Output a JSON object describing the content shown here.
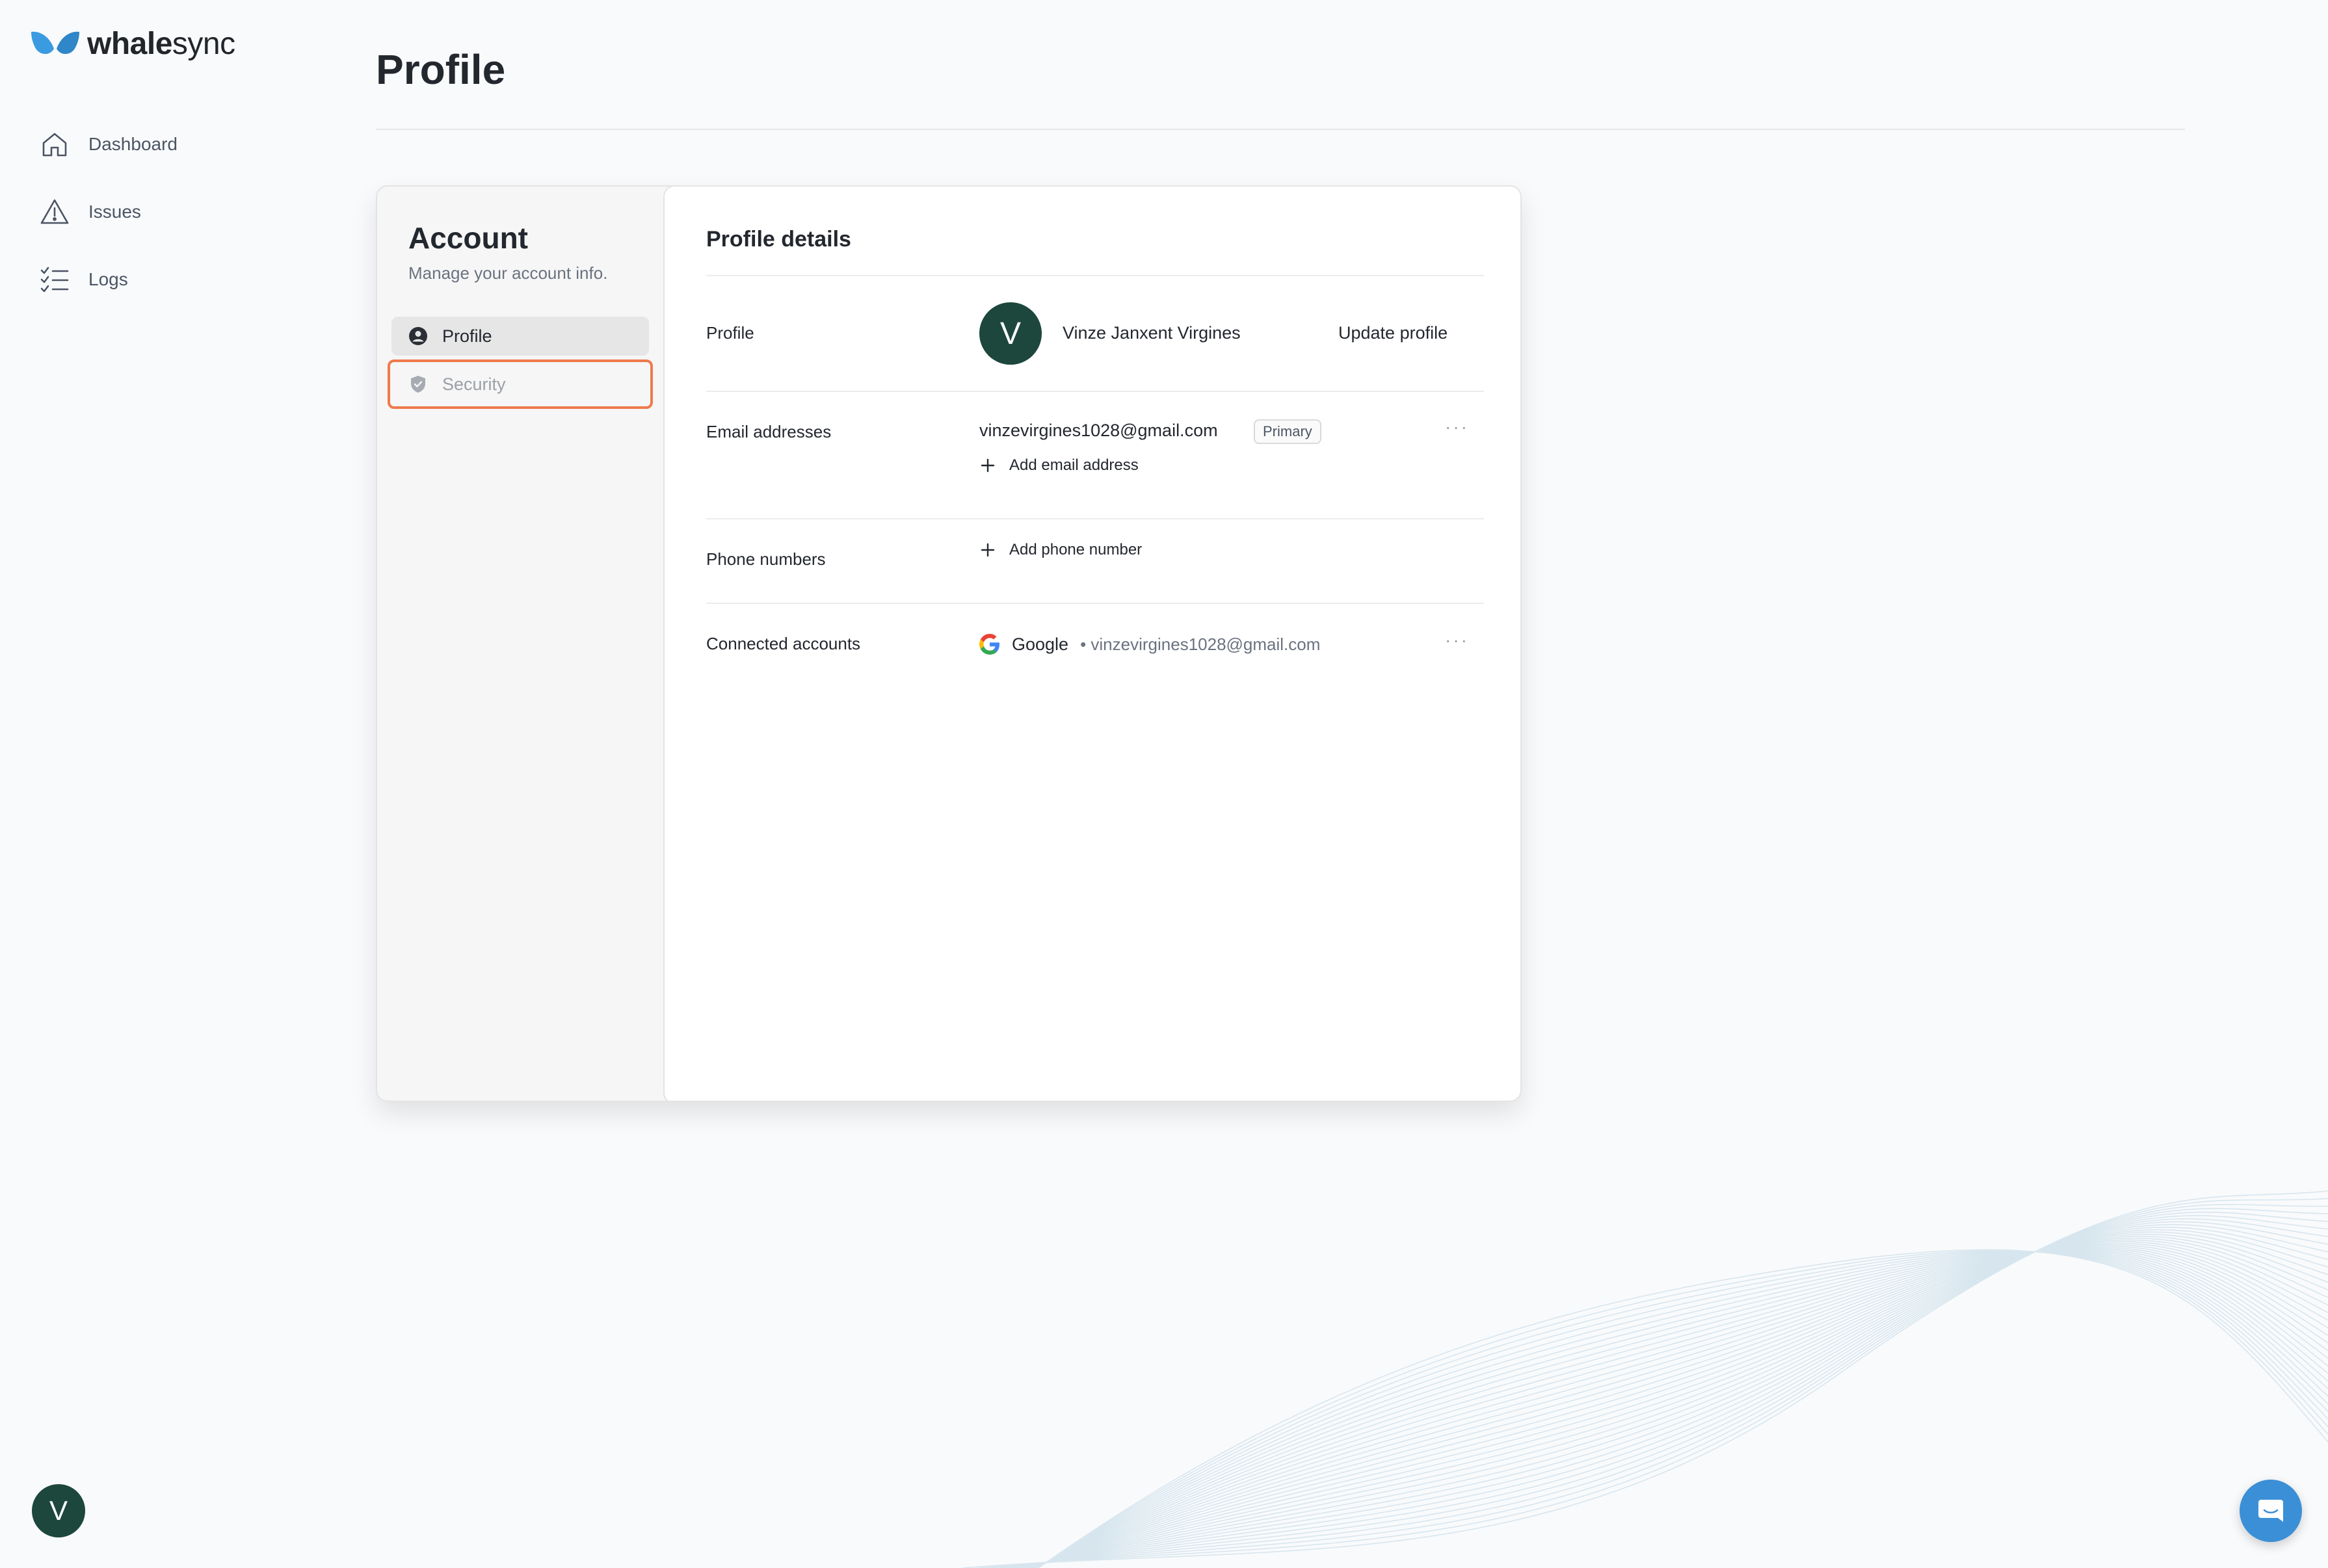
{
  "brand": {
    "name_bold": "whale",
    "name_rest": "sync"
  },
  "nav": {
    "items": [
      {
        "label": "Dashboard",
        "icon": "home-icon"
      },
      {
        "label": "Issues",
        "icon": "warning-icon"
      },
      {
        "label": "Logs",
        "icon": "list-check-icon"
      }
    ]
  },
  "user": {
    "initial": "V"
  },
  "page": {
    "title": "Profile"
  },
  "account": {
    "title": "Account",
    "subtitle": "Manage your account info.",
    "menu": [
      {
        "label": "Profile",
        "icon": "user-circle-icon",
        "active": true
      },
      {
        "label": "Security",
        "icon": "shield-icon",
        "active": false
      }
    ]
  },
  "profile_details": {
    "title": "Profile details",
    "profile_row": {
      "label": "Profile",
      "avatar_initial": "V",
      "full_name": "Vinze Janxent Virgines",
      "update_label": "Update profile"
    },
    "email_row": {
      "label": "Email addresses",
      "email": "vinzevirgines1028@gmail.com",
      "badge": "Primary",
      "more": "···",
      "add_label": "Add email address"
    },
    "phone_row": {
      "label": "Phone numbers",
      "add_label": "Add phone number"
    },
    "connected_row": {
      "label": "Connected accounts",
      "provider": "Google",
      "account_email": "• vinzevirgines1028@gmail.com",
      "more": "···"
    }
  },
  "colors": {
    "accent_green": "#1d473c",
    "focus_orange": "#ef7a4c",
    "chat_blue": "#3b8fd6",
    "logo_blue": "#3a9be0"
  }
}
